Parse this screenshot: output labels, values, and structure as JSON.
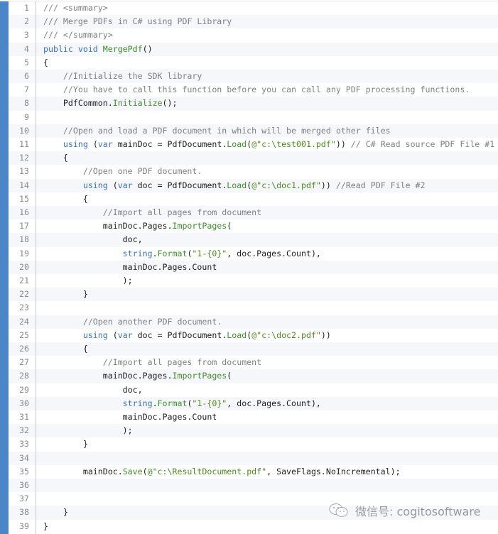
{
  "colors": {
    "accent_bar": "#4a86c8",
    "comment": "#808080",
    "keyword": "#3b73b9",
    "method": "#3e8f2a",
    "string": "#4d8a1c"
  },
  "watermark": {
    "icon": "wechat-icon",
    "text": "微信号: cogitosoftware"
  },
  "lines": [
    {
      "n": "1",
      "t": [
        [
          "c",
          "/// <summary>"
        ]
      ]
    },
    {
      "n": "2",
      "t": [
        [
          "c",
          "/// Merge PDFs in C# using PDF Library"
        ]
      ]
    },
    {
      "n": "3",
      "t": [
        [
          "c",
          "/// </summary>"
        ]
      ]
    },
    {
      "n": "4",
      "t": [
        [
          "k",
          "public void "
        ],
        [
          "m",
          "MergePdf"
        ],
        [
          "p",
          "()"
        ]
      ]
    },
    {
      "n": "5",
      "t": [
        [
          "p",
          "{"
        ]
      ]
    },
    {
      "n": "6",
      "t": [
        [
          "c",
          "    //Initialize the SDK library"
        ]
      ]
    },
    {
      "n": "7",
      "t": [
        [
          "c",
          "    //You have to call this function before you can call any PDF processing functions."
        ]
      ]
    },
    {
      "n": "8",
      "t": [
        [
          "p",
          "    PdfCommon."
        ],
        [
          "m",
          "Initialize"
        ],
        [
          "p",
          "();"
        ]
      ]
    },
    {
      "n": "9",
      "t": []
    },
    {
      "n": "10",
      "t": [
        [
          "c",
          "    //Open and load a PDF document in which will be merged other files"
        ]
      ]
    },
    {
      "n": "11",
      "t": [
        [
          "k",
          "    using "
        ],
        [
          "p",
          "("
        ],
        [
          "k",
          "var "
        ],
        [
          "p",
          "mainDoc = PdfDocument."
        ],
        [
          "m",
          "Load"
        ],
        [
          "p",
          "("
        ],
        [
          "s",
          "@\"c:\\test001.pdf\""
        ],
        [
          "p",
          "))"
        ],
        [
          "c",
          " // C# Read source PDF File #1"
        ]
      ]
    },
    {
      "n": "12",
      "t": [
        [
          "p",
          "    {"
        ]
      ]
    },
    {
      "n": "13",
      "t": [
        [
          "c",
          "        //Open one PDF document."
        ]
      ]
    },
    {
      "n": "14",
      "t": [
        [
          "k",
          "        using "
        ],
        [
          "p",
          "("
        ],
        [
          "k",
          "var "
        ],
        [
          "p",
          "doc = PdfDocument."
        ],
        [
          "m",
          "Load"
        ],
        [
          "p",
          "("
        ],
        [
          "s",
          "@\"c:\\doc1.pdf\""
        ],
        [
          "p",
          "))"
        ],
        [
          "c",
          " //Read PDF File #2"
        ]
      ]
    },
    {
      "n": "15",
      "t": [
        [
          "p",
          "        {"
        ]
      ]
    },
    {
      "n": "16",
      "t": [
        [
          "c",
          "            //Import all pages from document"
        ]
      ]
    },
    {
      "n": "17",
      "t": [
        [
          "p",
          "            mainDoc.Pages."
        ],
        [
          "m",
          "ImportPages"
        ],
        [
          "p",
          "("
        ]
      ]
    },
    {
      "n": "18",
      "t": [
        [
          "p",
          "                doc,"
        ]
      ]
    },
    {
      "n": "19",
      "t": [
        [
          "k",
          "                string"
        ],
        [
          "p",
          "."
        ],
        [
          "m",
          "Format"
        ],
        [
          "p",
          "("
        ],
        [
          "s",
          "\"1-{0}\""
        ],
        [
          "p",
          ", doc.Pages.Count),"
        ]
      ]
    },
    {
      "n": "20",
      "t": [
        [
          "p",
          "                mainDoc.Pages.Count"
        ]
      ]
    },
    {
      "n": "21",
      "t": [
        [
          "p",
          "                );"
        ]
      ]
    },
    {
      "n": "22",
      "t": [
        [
          "p",
          "        }"
        ]
      ]
    },
    {
      "n": "23",
      "t": []
    },
    {
      "n": "24",
      "t": [
        [
          "c",
          "        //Open another PDF document."
        ]
      ]
    },
    {
      "n": "25",
      "t": [
        [
          "k",
          "        using "
        ],
        [
          "p",
          "("
        ],
        [
          "k",
          "var "
        ],
        [
          "p",
          "doc = PdfDocument."
        ],
        [
          "m",
          "Load"
        ],
        [
          "p",
          "("
        ],
        [
          "s",
          "@\"c:\\doc2.pdf\""
        ],
        [
          "p",
          "))"
        ]
      ]
    },
    {
      "n": "26",
      "t": [
        [
          "p",
          "        {"
        ]
      ]
    },
    {
      "n": "27",
      "t": [
        [
          "c",
          "            //Import all pages from document"
        ]
      ]
    },
    {
      "n": "28",
      "t": [
        [
          "p",
          "            mainDoc.Pages."
        ],
        [
          "m",
          "ImportPages"
        ],
        [
          "p",
          "("
        ]
      ]
    },
    {
      "n": "29",
      "t": [
        [
          "p",
          "                doc,"
        ]
      ]
    },
    {
      "n": "30",
      "t": [
        [
          "k",
          "                string"
        ],
        [
          "p",
          "."
        ],
        [
          "m",
          "Format"
        ],
        [
          "p",
          "("
        ],
        [
          "s",
          "\"1-{0}\""
        ],
        [
          "p",
          ", doc.Pages.Count),"
        ]
      ]
    },
    {
      "n": "31",
      "t": [
        [
          "p",
          "                mainDoc.Pages.Count"
        ]
      ]
    },
    {
      "n": "32",
      "t": [
        [
          "p",
          "                );"
        ]
      ]
    },
    {
      "n": "33",
      "t": [
        [
          "p",
          "        }"
        ]
      ]
    },
    {
      "n": "34",
      "t": []
    },
    {
      "n": "35",
      "t": [
        [
          "p",
          "        mainDoc."
        ],
        [
          "m",
          "Save"
        ],
        [
          "p",
          "("
        ],
        [
          "s",
          "@\"c:\\ResultDocument.pdf\""
        ],
        [
          "p",
          ", SaveFlags.NoIncremental);"
        ]
      ]
    },
    {
      "n": "36",
      "t": []
    },
    {
      "n": "37",
      "t": []
    },
    {
      "n": "38",
      "t": [
        [
          "p",
          "    }"
        ]
      ]
    },
    {
      "n": "39",
      "t": [
        [
          "p",
          "}"
        ]
      ]
    }
  ]
}
